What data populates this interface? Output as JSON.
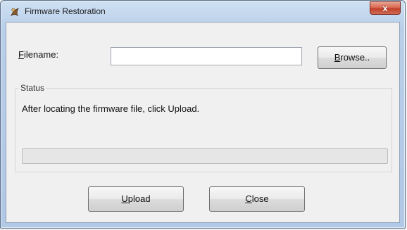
{
  "window": {
    "title": "Firmware Restoration",
    "close_symbol": "x"
  },
  "filename": {
    "label_hotkey": "F",
    "label_rest": "ilename:",
    "value": ""
  },
  "browse": {
    "hotkey": "B",
    "rest": "rowse.."
  },
  "status": {
    "legend": "Status",
    "message": "After locating the firmware file, click Upload.",
    "progress": 0
  },
  "buttons": {
    "upload": {
      "hotkey": "U",
      "rest": "pload"
    },
    "close": {
      "hotkey": "C",
      "rest": "lose"
    }
  },
  "colors": {
    "title_bar": "#b9cfe9",
    "close_button": "#c3402a",
    "client_bg": "#f0f0f0"
  },
  "icons": {
    "app": "asus-app-icon",
    "close": "close-icon"
  }
}
